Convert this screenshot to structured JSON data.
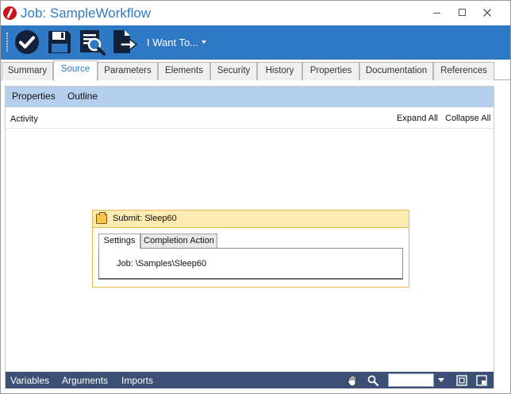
{
  "window": {
    "title": "Job: SampleWorkflow"
  },
  "toolbar": {
    "buttons": [
      {
        "name": "save-close-icon"
      },
      {
        "name": "save-icon"
      },
      {
        "name": "validate-icon"
      },
      {
        "name": "export-icon"
      }
    ],
    "menu_label": "I Want To..."
  },
  "tabs": [
    {
      "label": "Summary",
      "active": false
    },
    {
      "label": "Source",
      "active": true
    },
    {
      "label": "Parameters",
      "active": false
    },
    {
      "label": "Elements",
      "active": false
    },
    {
      "label": "Security",
      "active": false
    },
    {
      "label": "History",
      "active": false
    },
    {
      "label": "Properties",
      "active": false
    },
    {
      "label": "Documentation",
      "active": false
    },
    {
      "label": "References",
      "active": false
    }
  ],
  "subnav": {
    "items": [
      "Properties",
      "Outline"
    ]
  },
  "activity_bar": {
    "label": "Activity",
    "expand_all": "Expand All",
    "collapse_all": "Collapse All"
  },
  "activity": {
    "title": "Submit: Sleep60",
    "tabs": [
      "Settings",
      "Completion Action"
    ],
    "active_tab": "Settings",
    "field": "Job: \\Samples\\Sleep60"
  },
  "bottom_bar": {
    "items": [
      "Variables",
      "Arguments",
      "Imports"
    ],
    "zoom_value": ""
  },
  "colors": {
    "toolbar": "#2f78c4",
    "title": "#2f7bc6",
    "subnav": "#b6cfec",
    "activity_header": "#fdebb3",
    "bottom_bar": "#3b5074"
  }
}
